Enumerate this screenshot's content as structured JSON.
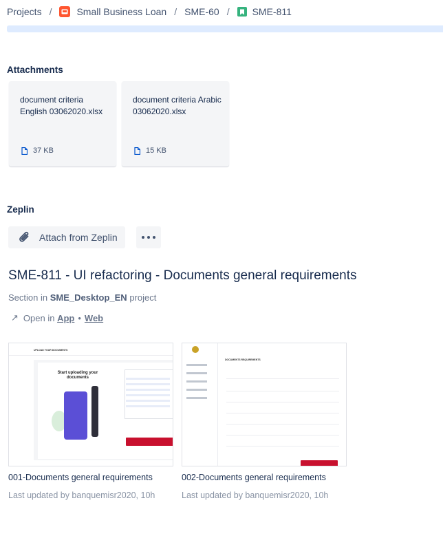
{
  "breadcrumb": {
    "root": "Projects",
    "project": "Small Business Loan",
    "parent": "SME-60",
    "issue": "SME-811"
  },
  "attachments": {
    "heading": "Attachments",
    "files": [
      {
        "name": "document criteria English 03062020.xlsx",
        "size": "37 KB"
      },
      {
        "name": "document criteria Arabic 03062020.xlsx",
        "size": "15 KB"
      }
    ]
  },
  "zeplin": {
    "heading": "Zeplin",
    "attach_label": "Attach from Zeplin",
    "title": "SME-811 - UI refactoring - Documents general requirements",
    "section_prefix": "Section in",
    "section_name": "SME_Desktop_EN",
    "section_suffix": "project",
    "open_in": "Open in",
    "open_app": "App",
    "open_web": "Web",
    "screens": [
      {
        "caption": "001-Documents general requirements",
        "meta": "Last updated by banquemisr2020, 10h"
      },
      {
        "caption": "002-Documents general requirements",
        "meta": "Last updated by banquemisr2020, 10h"
      }
    ]
  },
  "thumb1": {
    "header": "UPLOAD YOUR DOCUMENTS",
    "start": "Start uploading your documents"
  },
  "thumb2": {
    "title": "DOCUMENTS REQUIREMENTS"
  },
  "colors": {
    "project_icon": "#ff5630",
    "story_icon": "#36b37e",
    "progress_bar": "#deebff",
    "brand_red": "#c8102e"
  }
}
